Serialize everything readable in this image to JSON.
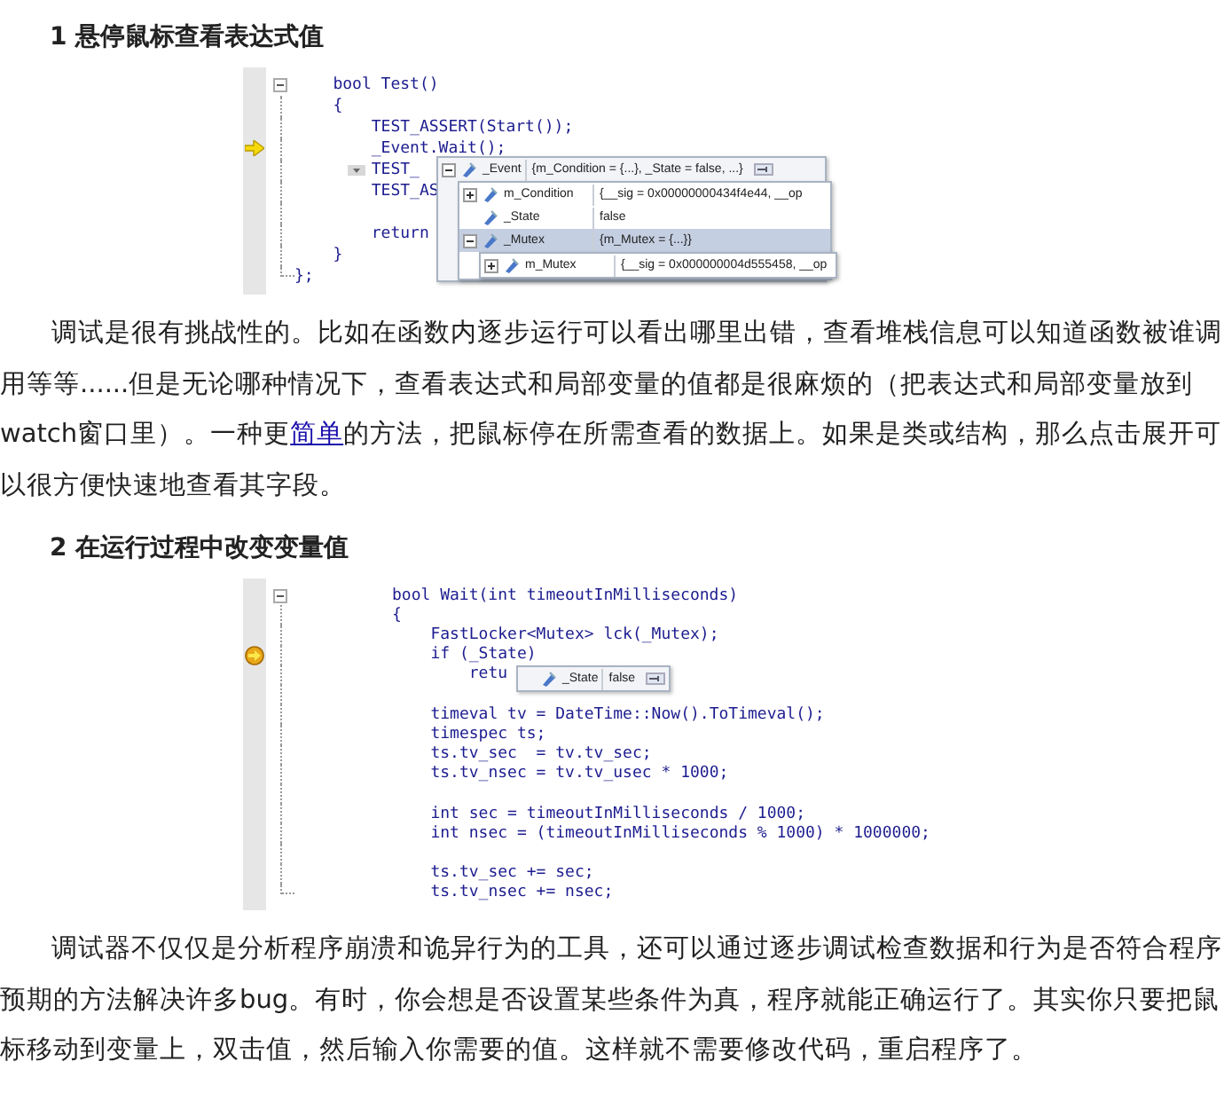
{
  "sections": [
    {
      "heading": "1 悬停鼠标查看表达式值",
      "code_view": {
        "lines": [
          {
            "kind": "plain",
            "text": "    bool Test()"
          },
          {
            "kind": "plain",
            "text": "    {"
          },
          {
            "kind": "plain",
            "text": "        TEST_ASSERT(Start());"
          },
          {
            "kind": "current",
            "text": "        _Event.Wait();"
          },
          {
            "kind": "plain",
            "text": "        TEST_",
            "smart_tag": true
          },
          {
            "kind": "plain",
            "text": "        TEST_AS"
          },
          {
            "kind": "blank"
          },
          {
            "kind": "plain",
            "text": "        return"
          },
          {
            "kind": "plain",
            "text": "    }"
          },
          {
            "kind": "plain",
            "text": "};"
          }
        ],
        "datatip": {
          "name": "_Event",
          "value": "{m_Condition = {...}, _State = false, ...}",
          "expanded": true,
          "selected": false,
          "children": [
            {
              "name": "m_Condition",
              "value": "{__sig = 0x00000000434f4e44, __op",
              "expanded": false,
              "selected": false
            },
            {
              "name": "_State",
              "value": "false",
              "selected": false
            },
            {
              "name": "_Mutex",
              "value": "{m_Mutex = {...}}",
              "expanded": true,
              "selected": true,
              "children": [
                {
                  "name": "m_Mutex",
                  "value": "{__sig = 0x000000004d555458, __op",
                  "expanded": false,
                  "selected": false
                }
              ]
            }
          ]
        }
      },
      "paragraph": [
        {
          "text": "调试是很有挑战性的。比如在函数内逐步运行可以看出哪里出错，查看堆栈信息可以知道函数被谁调用等等......但是无论哪种情况下，查看表达式和局部变量的值都是很麻烦的（把表达式和局部变量放到watch窗口里）。一种更",
          "link": false
        },
        {
          "text": "简单",
          "link": true
        },
        {
          "text": "的方法，把鼠标停在所需查看的数据上。如果是类或结构，那么点击展开可以很方便快速地查看其字段。",
          "link": false
        }
      ]
    },
    {
      "heading": "2 在运行过程中改变变量值",
      "code_view": {
        "lines": [
          {
            "kind": "plain",
            "text": "bool Wait(int timeoutInMilliseconds)"
          },
          {
            "kind": "plain",
            "text": "{"
          },
          {
            "kind": "plain",
            "text": "    FastLocker<Mutex> lck(_Mutex);"
          },
          {
            "kind": "breakpoint-current",
            "text": "    if (_State)"
          },
          {
            "kind": "plain",
            "text": "        retu"
          },
          {
            "kind": "blank"
          },
          {
            "kind": "plain",
            "text": "    timeval tv = DateTime::Now().ToTimeval();"
          },
          {
            "kind": "plain",
            "text": "    timespec ts;"
          },
          {
            "kind": "plain",
            "text": "    ts.tv_sec  = tv.tv_sec;"
          },
          {
            "kind": "plain",
            "text": "    ts.tv_nsec = tv.tv_usec * 1000;"
          },
          {
            "kind": "blank"
          },
          {
            "kind": "plain",
            "text": "    int sec = timeoutInMilliseconds / 1000;"
          },
          {
            "kind": "plain",
            "text": "    int nsec = (timeoutInMilliseconds % 1000) * 1000000;"
          },
          {
            "kind": "blank"
          },
          {
            "kind": "plain",
            "text": "    ts.tv_sec += sec;"
          },
          {
            "kind": "plain",
            "text": "    ts.tv_nsec += nsec;"
          }
        ],
        "datatip": {
          "name": "_State",
          "value": "false",
          "selected": false
        }
      },
      "paragraph": [
        {
          "text": "调试器不仅仅是分析程序崩溃和诡异行为的工具，还可以通过逐步调试检查数据和行为是否符合程序预期的方法解决许多bug。有时，你会想是否设置某些条件为真，程序就能正确运行了。其实你只要把鼠标移动到变量上，双击值，然后输入你需要的值。这样就不需要修改代码，重启程序了。",
          "link": false
        }
      ]
    }
  ]
}
